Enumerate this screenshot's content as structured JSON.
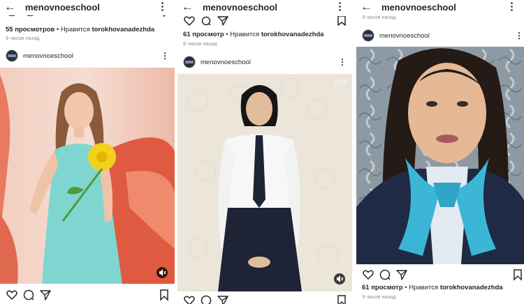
{
  "app": {
    "header_username": "menovnoeschool",
    "back_icon": "arrow-left-icon",
    "menu_icon": "vertical-dots-icon"
  },
  "colors": {
    "post1_background": "#e98a7a",
    "post2_background": "#e8e2d7",
    "post3_background": "#3a5f75",
    "scarf": "#3bb6d6"
  },
  "panels": [
    {
      "prev_views": "55 просмотров",
      "prev_liked_prefix": "• Нравится",
      "prev_liked_user": "torokhovanadezhda",
      "prev_time": "9 часов назад",
      "post_user": "menovnoeschool",
      "post_icons": [
        "heart-icon",
        "comment-icon",
        "send-icon",
        "bookmark-icon"
      ],
      "media_description_icon": "mute-icon"
    },
    {
      "prev_views": "61 просмотр",
      "prev_liked_prefix": "• Нравится",
      "prev_liked_user": "torokhovanadezhda",
      "prev_time": "9 часов назад",
      "post_user": "menovnoeschool",
      "duration": "0:25",
      "post_icons": [
        "heart-icon",
        "comment-icon",
        "send-icon",
        "bookmark-icon"
      ]
    },
    {
      "prev_time": "9 часов назад",
      "post_user": "menovnoeschool",
      "views": "61 просмотр",
      "liked_prefix": "• Нравится",
      "liked_user": "torokhovanadezhda",
      "time": "9 часов назад",
      "post_icons": [
        "heart-icon",
        "comment-icon",
        "send-icon",
        "bookmark-icon"
      ]
    }
  ]
}
